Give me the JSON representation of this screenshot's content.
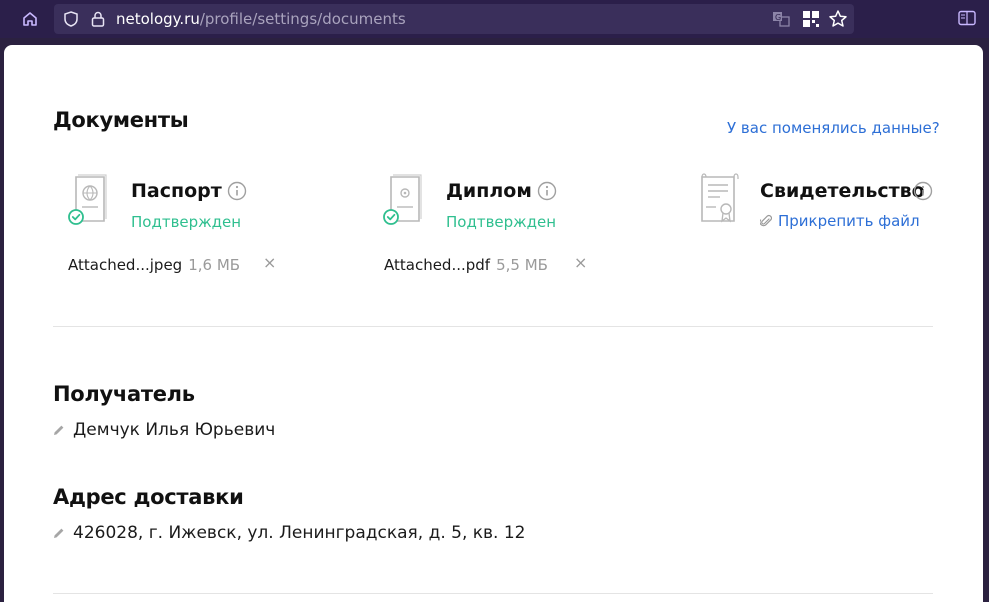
{
  "browser": {
    "url_domain": "netology.ru",
    "url_path": "/profile/settings/documents",
    "icons": [
      "home-icon",
      "shield-icon",
      "lock-icon",
      "translate-icon",
      "qr-code-icon",
      "star-icon",
      "reader-view-icon"
    ]
  },
  "documents": {
    "heading": "Документы",
    "changed_link": "У вас поменялись данные?",
    "passport": {
      "title": "Паспорт",
      "status": "Подтвержден",
      "file_name": "Attached...jpeg",
      "file_size": "1,6 МБ"
    },
    "diploma": {
      "title": "Диплом",
      "status": "Подтвержден",
      "file_name": "Attached...pdf",
      "file_size": "5,5 МБ"
    },
    "certificate": {
      "title": "Свидетельство",
      "attach_label": "Прикрепить файл"
    },
    "remove_glyph": "×"
  },
  "recipient": {
    "heading": "Получатель",
    "value": "Демчук Илья Юрьевич"
  },
  "address": {
    "heading": "Адрес доставки",
    "value": "426028, г. Ижевск, ул. Ленинградская, д. 5, кв. 12"
  },
  "colors": {
    "accent_link": "#2d6fd6",
    "status_green": "#2fbf8f",
    "chrome_bg": "#2b1f4a"
  }
}
